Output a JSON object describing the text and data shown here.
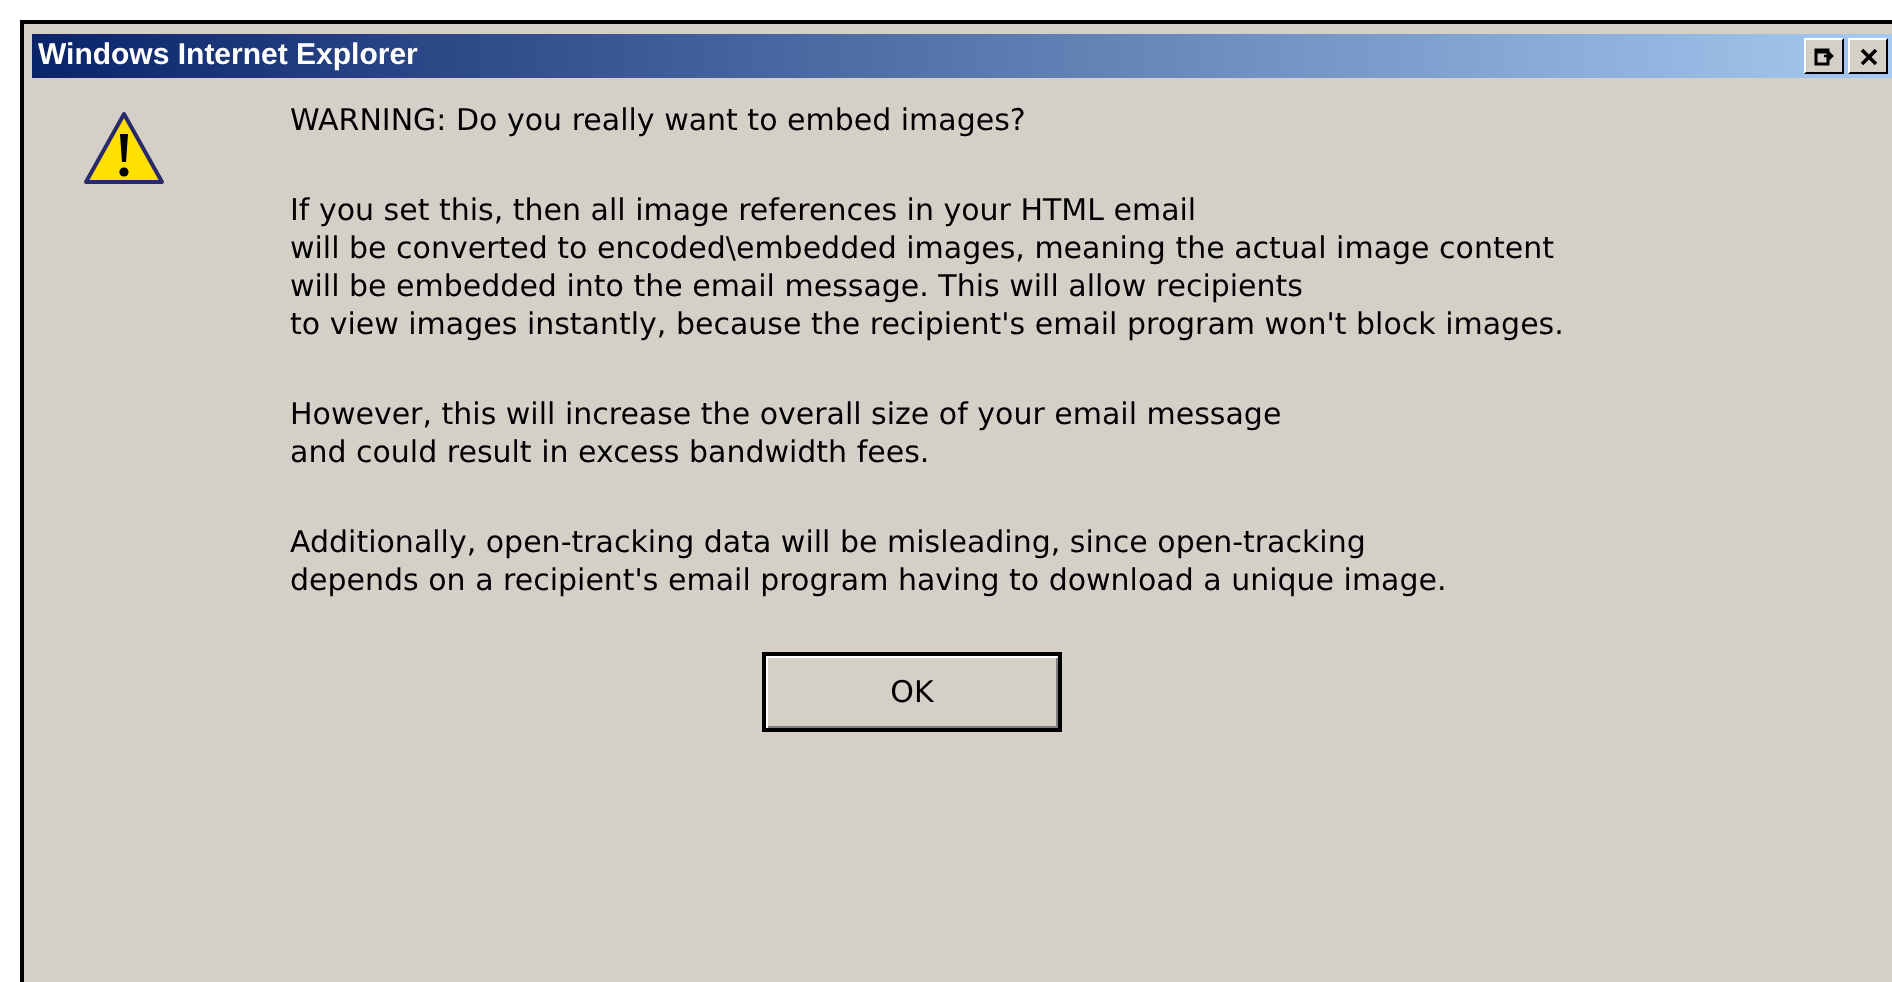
{
  "window": {
    "title": "Windows Internet Explorer"
  },
  "message": {
    "heading": "WARNING: Do you really want to embed images?",
    "paragraphs": [
      [
        "If you set this, then all image references in your HTML email",
        "will be converted to encoded\\embedded images, meaning the actual image content",
        "will be embedded into the email message. This will allow recipients",
        "to view images instantly, because the recipient's email program won't block images."
      ],
      [
        "However, this will increase the overall size of your email message",
        "and could result in excess bandwidth fees."
      ],
      [
        "Additionally, open-tracking data will be misleading, since open-tracking",
        "depends on a recipient's email program having to download a unique image."
      ]
    ]
  },
  "buttons": [
    "OK"
  ]
}
